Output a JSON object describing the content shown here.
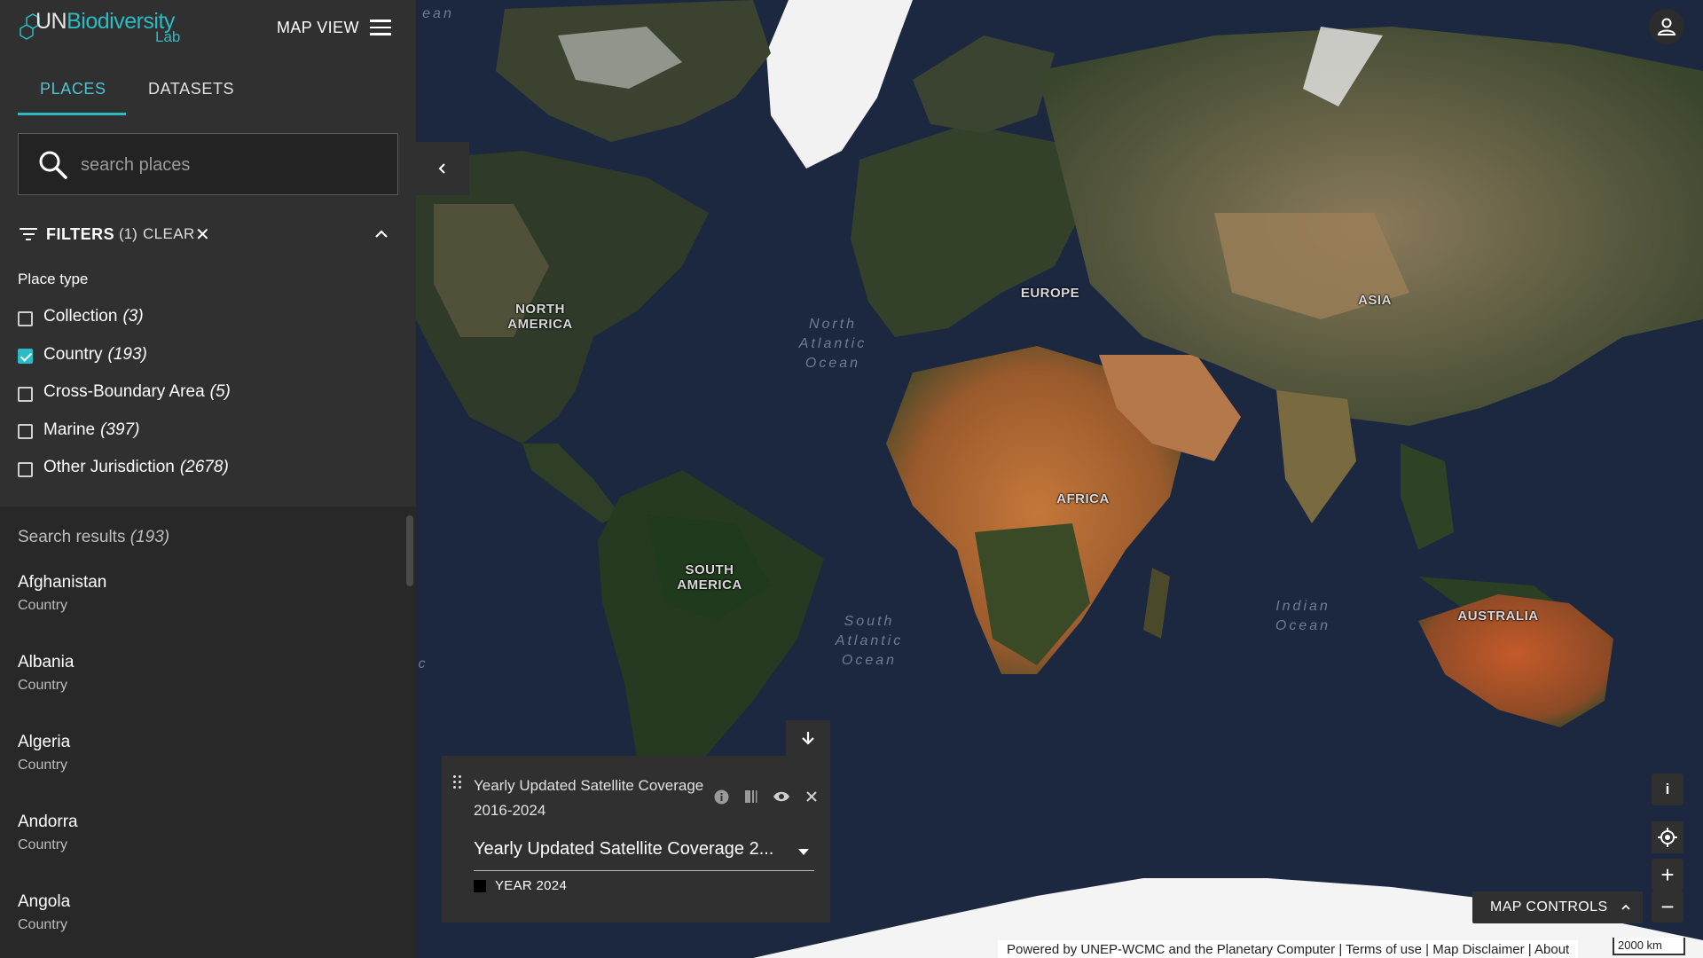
{
  "header": {
    "logo_un": "UN",
    "logo_bio": "Biodiversity",
    "logo_lab": "Lab",
    "mapview_label": "MAP VIEW",
    "menu_icon": "hamburger-menu-icon"
  },
  "tabs": [
    {
      "label": "PLACES",
      "active": true
    },
    {
      "label": "DATASETS",
      "active": false
    }
  ],
  "search": {
    "placeholder": "search places",
    "value": ""
  },
  "filters": {
    "label": "FILTERS",
    "count": "(1)",
    "clear_label": "CLEAR",
    "clear_icon": "✕",
    "place_type_title": "Place type",
    "options": [
      {
        "label": "Collection",
        "count": "(3)",
        "checked": false
      },
      {
        "label": "Country",
        "count": "(193)",
        "checked": true
      },
      {
        "label": "Cross-Boundary Area",
        "count": "(5)",
        "checked": false
      },
      {
        "label": "Marine",
        "count": "(397)",
        "checked": false
      },
      {
        "label": "Other Jurisdiction",
        "count": "(2678)",
        "checked": false
      }
    ]
  },
  "results": {
    "title": "Search results",
    "count": "(193)",
    "items": [
      {
        "name": "Afghanistan",
        "type": "Country"
      },
      {
        "name": "Albania",
        "type": "Country"
      },
      {
        "name": "Algeria",
        "type": "Country"
      },
      {
        "name": "Andorra",
        "type": "Country"
      },
      {
        "name": "Angola",
        "type": "Country"
      }
    ]
  },
  "map": {
    "continents": {
      "north_america": "NORTH\nAMERICA",
      "south_america": "SOUTH\nAMERICA",
      "europe": "EUROPE",
      "africa": "AFRICA",
      "asia": "ASIA",
      "australia": "AUSTRALIA"
    },
    "oceans": {
      "north_atlantic": "North\nAtlantic\nOcean",
      "south_atlantic": "South\nAtlantic\nOcean",
      "indian": "Indian\nOcean",
      "edge_top": "ean",
      "edge_left": "c"
    }
  },
  "layer": {
    "title": "Yearly Updated Satellite Coverage 2016-2024",
    "selected": "Yearly Updated Satellite Coverage 2...",
    "legend_label": "YEAR 2024",
    "legend_color": "#000000",
    "icons": [
      "info-icon",
      "opacity-icon",
      "visibility-eye-icon",
      "close-icon"
    ]
  },
  "controls": {
    "map_controls_label": "MAP CONTROLS",
    "info": "i",
    "zoom_in": "+",
    "zoom_out": "−"
  },
  "attribution": {
    "powered": "Powered by UNEP-WCMC and the Planetary Computer",
    "sep": " | ",
    "terms": "Terms of use",
    "disclaimer": "Map Disclaimer",
    "about": "About"
  },
  "scale_label": "2000 km",
  "colors": {
    "accent": "#2bbbc4",
    "panel": "#303030",
    "ocean": "#1d2840"
  }
}
